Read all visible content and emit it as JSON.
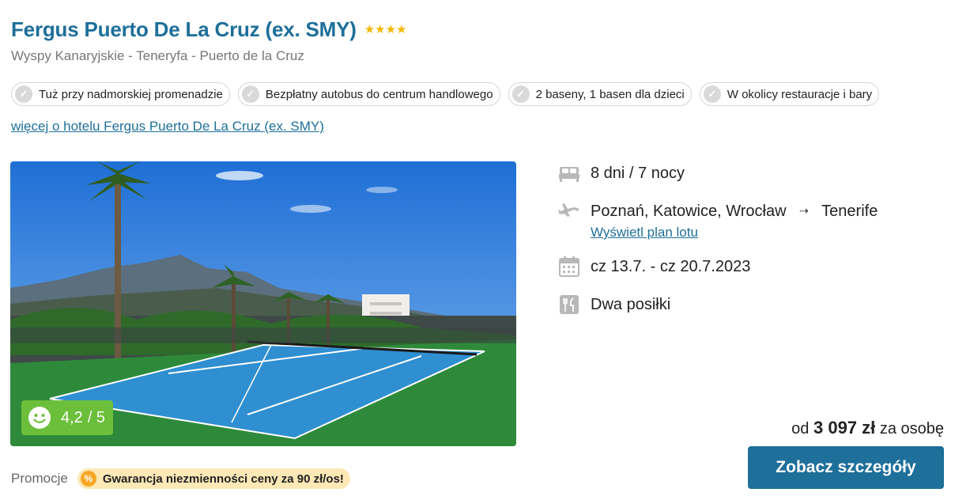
{
  "hotel": {
    "name": "Fergus Puerto De La Cruz (ex. SMY)",
    "stars": "★★★★",
    "location": "Wyspy Kanaryjskie - Teneryfa - Puerto de la Cruz",
    "more_link": "więcej o hotelu Fergus Puerto De La Cruz (ex. SMY)"
  },
  "features": [
    "Tuż przy nadmorskiej promenadzie",
    "Bezpłatny autobus do centrum handlowego",
    "2 baseny, 1 basen dla dzieci",
    "W okolicy restauracje i bary"
  ],
  "rating": {
    "value": "4,2",
    "max": "/ 5"
  },
  "details": {
    "duration": "8 dni / 7 nocy",
    "departure": "Poznań, Katowice, Wrocław",
    "arrow": "⇢",
    "destination": "Tenerife",
    "flight_link": "Wyświetl plan lotu",
    "dates": "cz 13.7. - cz 20.7.2023",
    "board": "Dwa posiłki"
  },
  "price": {
    "prefix": "od",
    "amount": "3 097 zł",
    "suffix": "za osobę"
  },
  "cta_label": "Zobacz szczegóły",
  "promo": {
    "label": "Promocje",
    "badge": "Gwarancja niezmienności ceny za 90 zł/os!",
    "icon": "%"
  },
  "colors": {
    "brand": "#1e6f9a",
    "rating": "#6cbf3a",
    "star": "#f5b800",
    "promo_bg": "#fde8b6"
  }
}
